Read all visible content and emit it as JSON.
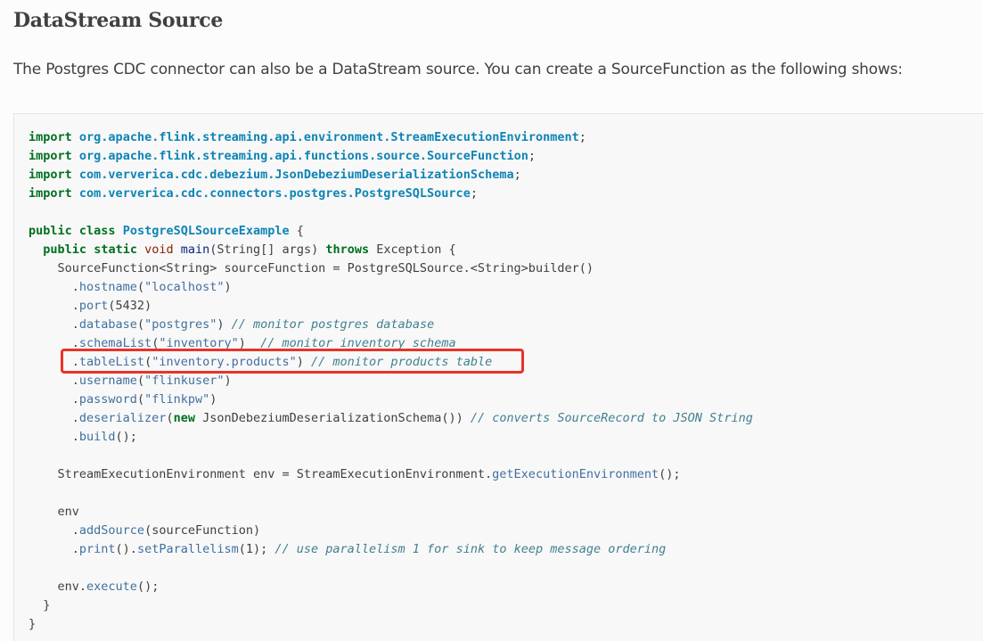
{
  "heading": "DataStream Source",
  "paragraph": "The Postgres CDC connector can also be a DataStream source. You can create a SourceFunction as the following shows:",
  "code": {
    "lines": [
      [
        [
          "kw",
          "import"
        ],
        [
          "t",
          " "
        ],
        [
          "nn",
          "org.apache.flink.streaming.api.environment.StreamExecutionEnvironment"
        ],
        [
          "t",
          ";"
        ]
      ],
      [
        [
          "kw",
          "import"
        ],
        [
          "t",
          " "
        ],
        [
          "nn",
          "org.apache.flink.streaming.api.functions.source.SourceFunction"
        ],
        [
          "t",
          ";"
        ]
      ],
      [
        [
          "kw",
          "import"
        ],
        [
          "t",
          " "
        ],
        [
          "nn",
          "com.ververica.cdc.debezium.JsonDebeziumDeserializationSchema"
        ],
        [
          "t",
          ";"
        ]
      ],
      [
        [
          "kw",
          "import"
        ],
        [
          "t",
          " "
        ],
        [
          "nn",
          "com.ververica.cdc.connectors.postgres.PostgreSQLSource"
        ],
        [
          "t",
          ";"
        ]
      ],
      [],
      [
        [
          "kw",
          "public"
        ],
        [
          "t",
          " "
        ],
        [
          "kw",
          "class"
        ],
        [
          "t",
          " "
        ],
        [
          "nc",
          "PostgreSQLSourceExample"
        ],
        [
          "t",
          " {"
        ]
      ],
      [
        [
          "t",
          "  "
        ],
        [
          "kw",
          "public"
        ],
        [
          "t",
          " "
        ],
        [
          "kw",
          "static"
        ],
        [
          "t",
          " "
        ],
        [
          "kt",
          "void"
        ],
        [
          "t",
          " "
        ],
        [
          "nf",
          "main"
        ],
        [
          "t",
          "(String[] args) "
        ],
        [
          "kw",
          "throws"
        ],
        [
          "t",
          " Exception {"
        ]
      ],
      [
        [
          "t",
          "    SourceFunction<String> sourceFunction = PostgreSQLSource.<String>builder()"
        ]
      ],
      [
        [
          "t",
          "      ."
        ],
        [
          "na",
          "hostname"
        ],
        [
          "t",
          "("
        ],
        [
          "s",
          "\"localhost\""
        ],
        [
          "t",
          ")"
        ]
      ],
      [
        [
          "t",
          "      ."
        ],
        [
          "na",
          "port"
        ],
        [
          "t",
          "(5432)"
        ]
      ],
      [
        [
          "t",
          "      ."
        ],
        [
          "na",
          "database"
        ],
        [
          "t",
          "("
        ],
        [
          "s",
          "\"postgres\""
        ],
        [
          "t",
          ") "
        ],
        [
          "c",
          "// monitor postgres database"
        ]
      ],
      [
        [
          "t",
          "      ."
        ],
        [
          "na",
          "schemaList"
        ],
        [
          "t",
          "("
        ],
        [
          "s",
          "\"inventory\""
        ],
        [
          "t",
          ")  "
        ],
        [
          "c",
          "// monitor inventory schema"
        ]
      ],
      [
        [
          "t",
          "      ."
        ],
        [
          "na",
          "tableList"
        ],
        [
          "t",
          "("
        ],
        [
          "s",
          "\"inventory.products\""
        ],
        [
          "t",
          ") "
        ],
        [
          "c",
          "// monitor products table"
        ]
      ],
      [
        [
          "t",
          "      ."
        ],
        [
          "na",
          "username"
        ],
        [
          "t",
          "("
        ],
        [
          "s",
          "\"flinkuser\""
        ],
        [
          "t",
          ")"
        ]
      ],
      [
        [
          "t",
          "      ."
        ],
        [
          "na",
          "password"
        ],
        [
          "t",
          "("
        ],
        [
          "s",
          "\"flinkpw\""
        ],
        [
          "t",
          ")"
        ]
      ],
      [
        [
          "t",
          "      ."
        ],
        [
          "na",
          "deserializer"
        ],
        [
          "t",
          "("
        ],
        [
          "kw",
          "new"
        ],
        [
          "t",
          " JsonDebeziumDeserializationSchema()) "
        ],
        [
          "c",
          "// converts SourceRecord to JSON String"
        ]
      ],
      [
        [
          "t",
          "      ."
        ],
        [
          "na",
          "build"
        ],
        [
          "t",
          "();"
        ]
      ],
      [],
      [
        [
          "t",
          "    StreamExecutionEnvironment env = StreamExecutionEnvironment."
        ],
        [
          "na",
          "getExecutionEnvironment"
        ],
        [
          "t",
          "();"
        ]
      ],
      [],
      [
        [
          "t",
          "    env"
        ]
      ],
      [
        [
          "t",
          "      ."
        ],
        [
          "na",
          "addSource"
        ],
        [
          "t",
          "(sourceFunction)"
        ]
      ],
      [
        [
          "t",
          "      ."
        ],
        [
          "na",
          "print"
        ],
        [
          "t",
          "()."
        ],
        [
          "na",
          "setParallelism"
        ],
        [
          "t",
          "(1); "
        ],
        [
          "c",
          "// use parallelism 1 for sink to keep message ordering"
        ]
      ],
      [],
      [
        [
          "t",
          "    env."
        ],
        [
          "na",
          "execute"
        ],
        [
          "t",
          "();"
        ]
      ],
      [
        [
          "t",
          "  }"
        ]
      ],
      [
        [
          "t",
          "}"
        ]
      ]
    ]
  },
  "annotation": {
    "color": "#e8332a",
    "highlighted_line": 12
  }
}
